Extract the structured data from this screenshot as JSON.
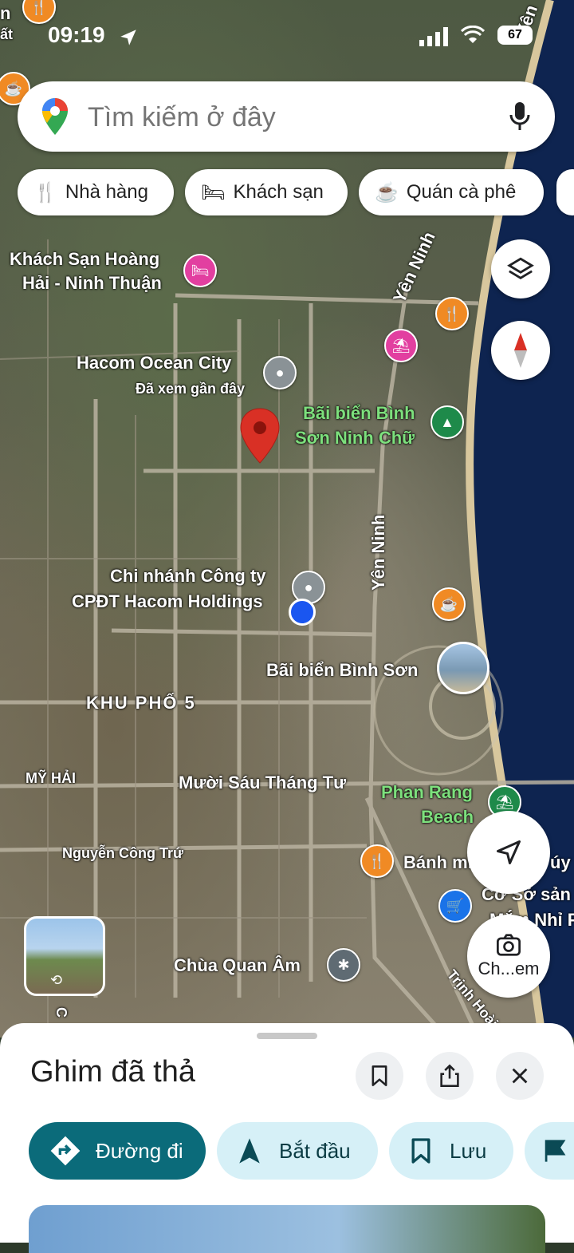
{
  "status": {
    "time": "09:19",
    "battery": "67"
  },
  "search": {
    "placeholder": "Tìm kiếm ở đây"
  },
  "chips": [
    {
      "label": "Nhà hàng",
      "icon": "fork-knife-icon"
    },
    {
      "label": "Khách sạn",
      "icon": "bed-icon"
    },
    {
      "label": "Quán cà phê",
      "icon": "coffee-icon"
    }
  ],
  "map": {
    "labels": {
      "top_left_1": "n",
      "top_left_2": "ất",
      "hotel": "Khách Sạn Hoàng",
      "hotel2": "Hải - Ninh Thuận",
      "hacom": "Hacom Ocean City",
      "hacom_sub": "Đã xem gần đây",
      "beach1a": "Bãi biển Bình",
      "beach1b": "Sơn Ninh Chữ",
      "yen_ninh_1": "Yên Ninh",
      "yen_ninh_2": "Yên Ninh",
      "top_right_road": "Yên",
      "branch1": "Chi nhánh Công ty",
      "branch2": "CPĐT Hacom Holdings",
      "beach2": "Bãi biển Bình Sơn",
      "khu_pho": "KHU PHỐ 5",
      "my_hai": "MỸ HẢI",
      "muoi_sau": "Mười Sáu Tháng Tư",
      "phan_rang1": "Phan Rang",
      "phan_rang2": "Beach",
      "nguyen_cong_tru": "Nguyễn Công Trứ",
      "banh_mi": "Bánh mì",
      "banh_mi_right": "úy",
      "co_so": "Cơ Sở sản",
      "mam_nhi": "Mắm Nhỉ P",
      "chua": "Chùa Quan Âm",
      "trinh_hoai": "Trịnh Hoài",
      "left_c": "C"
    },
    "camera_label": "Ch...em"
  },
  "sheet": {
    "title": "Ghim đã thả",
    "actions": [
      {
        "label": "Đường đi",
        "icon": "directions-icon"
      },
      {
        "label": "Bắt đầu",
        "icon": "navigation-arrow-icon"
      },
      {
        "label": "Lưu",
        "icon": "bookmark-icon"
      }
    ]
  },
  "colors": {
    "accent": "#0b6b7a",
    "chip_bg": "#d6f0f7",
    "pin_red": "#d93025",
    "user_blue": "#1a56f0",
    "sea": "#0e2450"
  }
}
